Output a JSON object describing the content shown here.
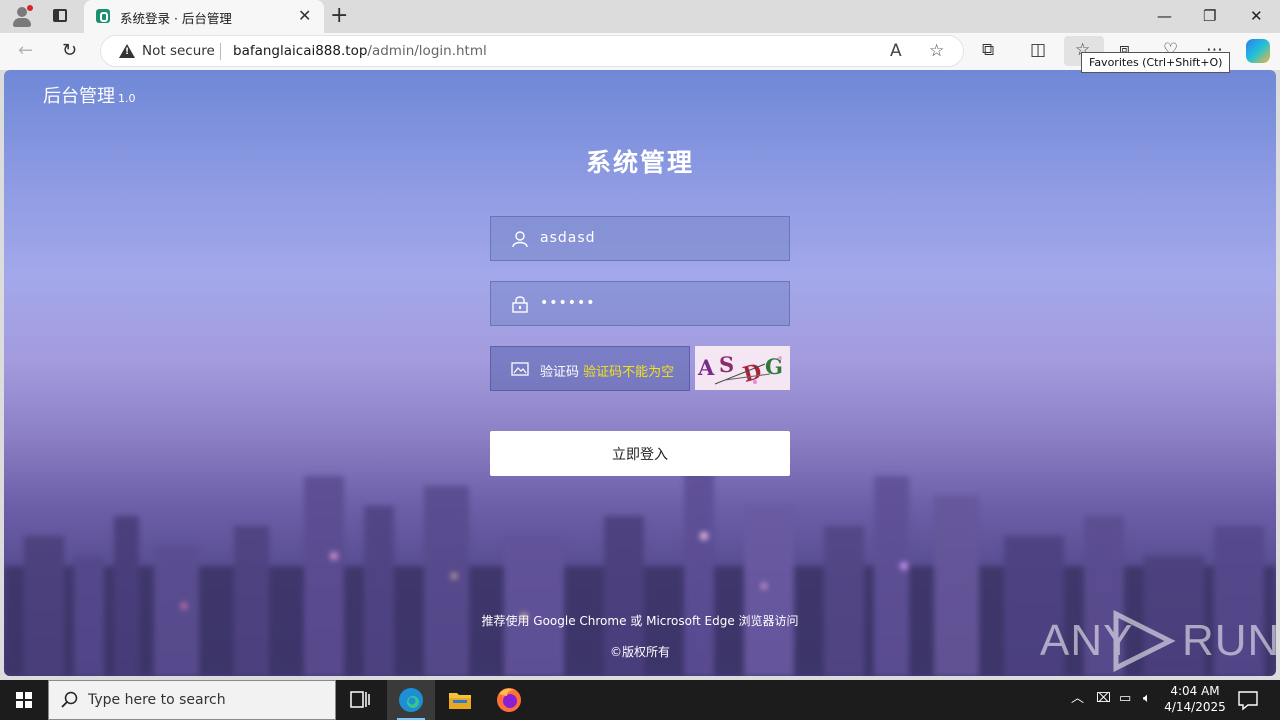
{
  "browser": {
    "tab_title": "系统登录 · 后台管理",
    "tab_close": "✕",
    "new_tab": "+",
    "security_label": "Not secure",
    "url_host": "bafanglaicai888.top",
    "url_path": "/admin/login.html",
    "tooltip": "Favorites (Ctrl+Shift+O)",
    "window_controls": {
      "minimize": "—",
      "restore": "❐",
      "close": "✕"
    }
  },
  "page": {
    "brand": "后台管理",
    "version": "1.0",
    "heading": "系统管理",
    "username_value": "asdasd",
    "password_value": "••••••",
    "captcha_label": "验证码",
    "captcha_placeholder": "验证码不能为空",
    "captcha_chars": [
      "A",
      "S",
      "D",
      "G"
    ],
    "login_button": "立即登入",
    "footer_note": "推荐使用 Google Chrome 或 Microsoft Edge 浏览器访问",
    "copyright": "©版权所有"
  },
  "watermark": {
    "left": "ANY",
    "right": "RUN"
  },
  "taskbar": {
    "search_placeholder": "Type here to search",
    "time": "4:04 AM",
    "date": "4/14/2025"
  },
  "colors": {
    "captcha_placeholder": "#f3e21a",
    "bg_top": "#6f88d6",
    "bg_bottom": "#463c79"
  }
}
